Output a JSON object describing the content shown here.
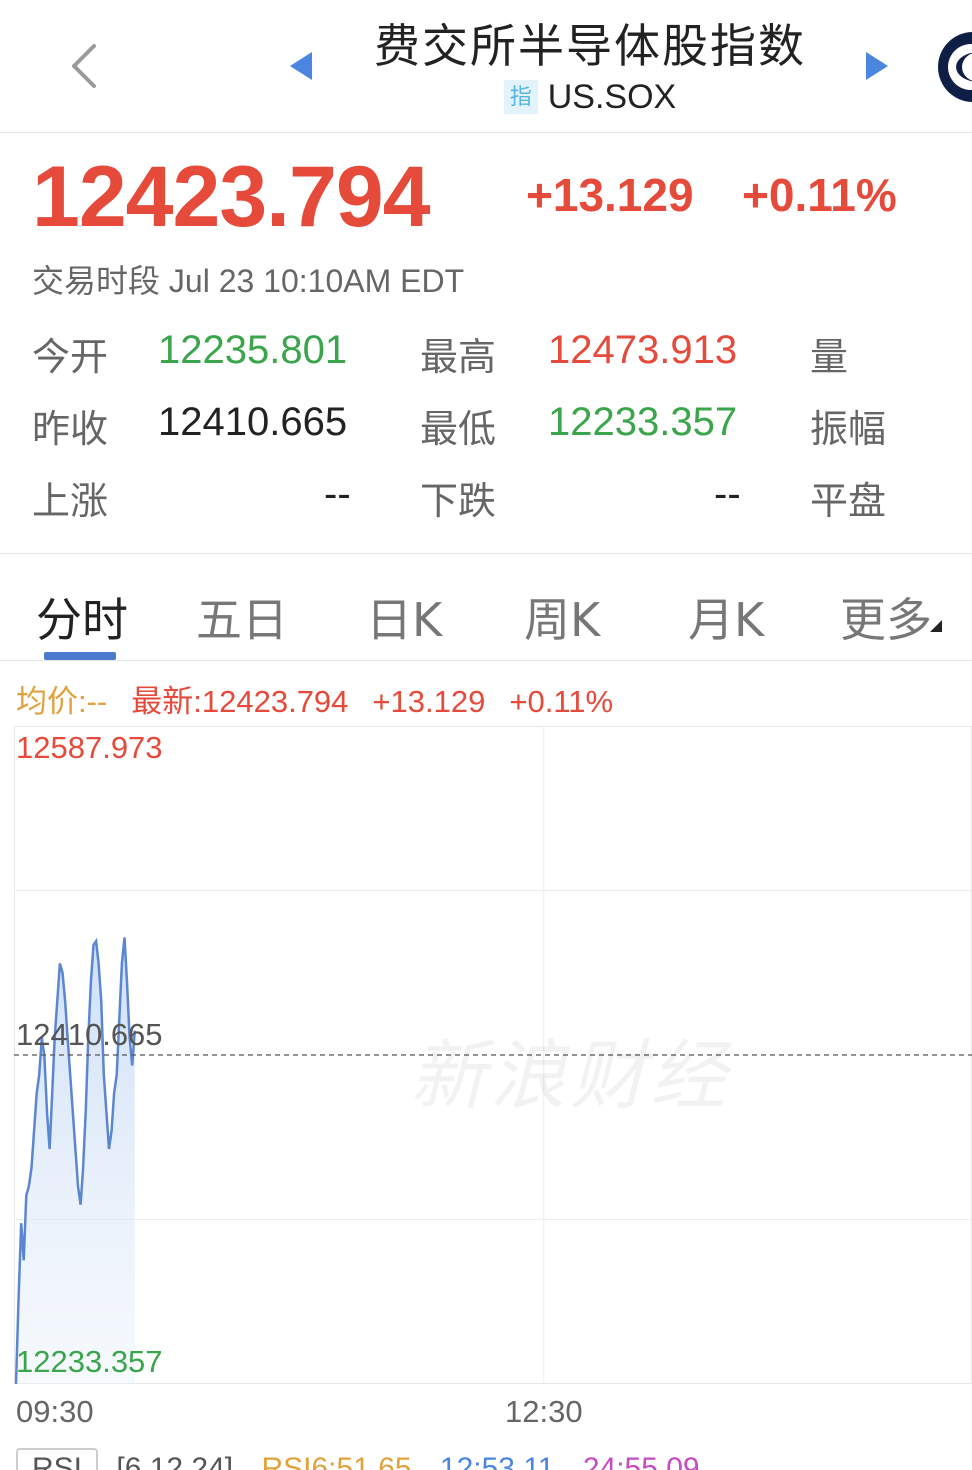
{
  "header": {
    "title": "费交所半导体股指数",
    "badge": "指",
    "symbol": "US.SOX"
  },
  "quote": {
    "price": "12423.794",
    "change": "+13.129",
    "change_pct": "+0.11%",
    "session": "交易时段 Jul 23 10:10AM EDT"
  },
  "stats": {
    "open_label": "今开",
    "open_value": "12235.801",
    "high_label": "最高",
    "high_value": "12473.913",
    "volume_label": "量",
    "prev_close_label": "昨收",
    "prev_close_value": "12410.665",
    "low_label": "最低",
    "low_value": "12233.357",
    "amplitude_label": "振幅",
    "up_label": "上涨",
    "up_value": "--",
    "down_label": "下跌",
    "down_value": "--",
    "flat_label": "平盘"
  },
  "tabs": [
    "分时",
    "五日",
    "日K",
    "周K",
    "月K",
    "更多"
  ],
  "active_tab": "分时",
  "info_bar": {
    "avg": "均价:--",
    "latest": "最新:12423.794",
    "change": "+13.129",
    "change_pct": "+0.11%"
  },
  "chart_data": {
    "type": "line",
    "x_ticks": [
      "09:30",
      "12:30"
    ],
    "y_ticks": [
      "12587.973",
      "12410.665",
      "12233.357"
    ],
    "ylim": [
      12233.357,
      12587.973
    ],
    "reference_line": 12410.665,
    "series": [
      {
        "values": [
          12233.4,
          12280,
          12320,
          12300,
          12335,
          12340,
          12350,
          12370,
          12390,
          12400,
          12420,
          12410,
          12380,
          12360,
          12390,
          12420,
          12440,
          12460,
          12455,
          12440,
          12420,
          12400,
          12380,
          12360,
          12340,
          12330,
          12350,
          12380,
          12420,
          12450,
          12470,
          12472,
          12460,
          12440,
          12400,
          12380,
          12360,
          12370,
          12390,
          12400,
          12430,
          12460,
          12474,
          12450,
          12420,
          12405,
          12423.8
        ]
      }
    ],
    "watermark": "新浪财经"
  },
  "bottom_bar": {
    "rsi_label": "RSI",
    "params": "[6,12,24]",
    "rsi6": "RSI6:51.65",
    "rsi12": "12:53.11",
    "rsi24": "24:55.09"
  }
}
